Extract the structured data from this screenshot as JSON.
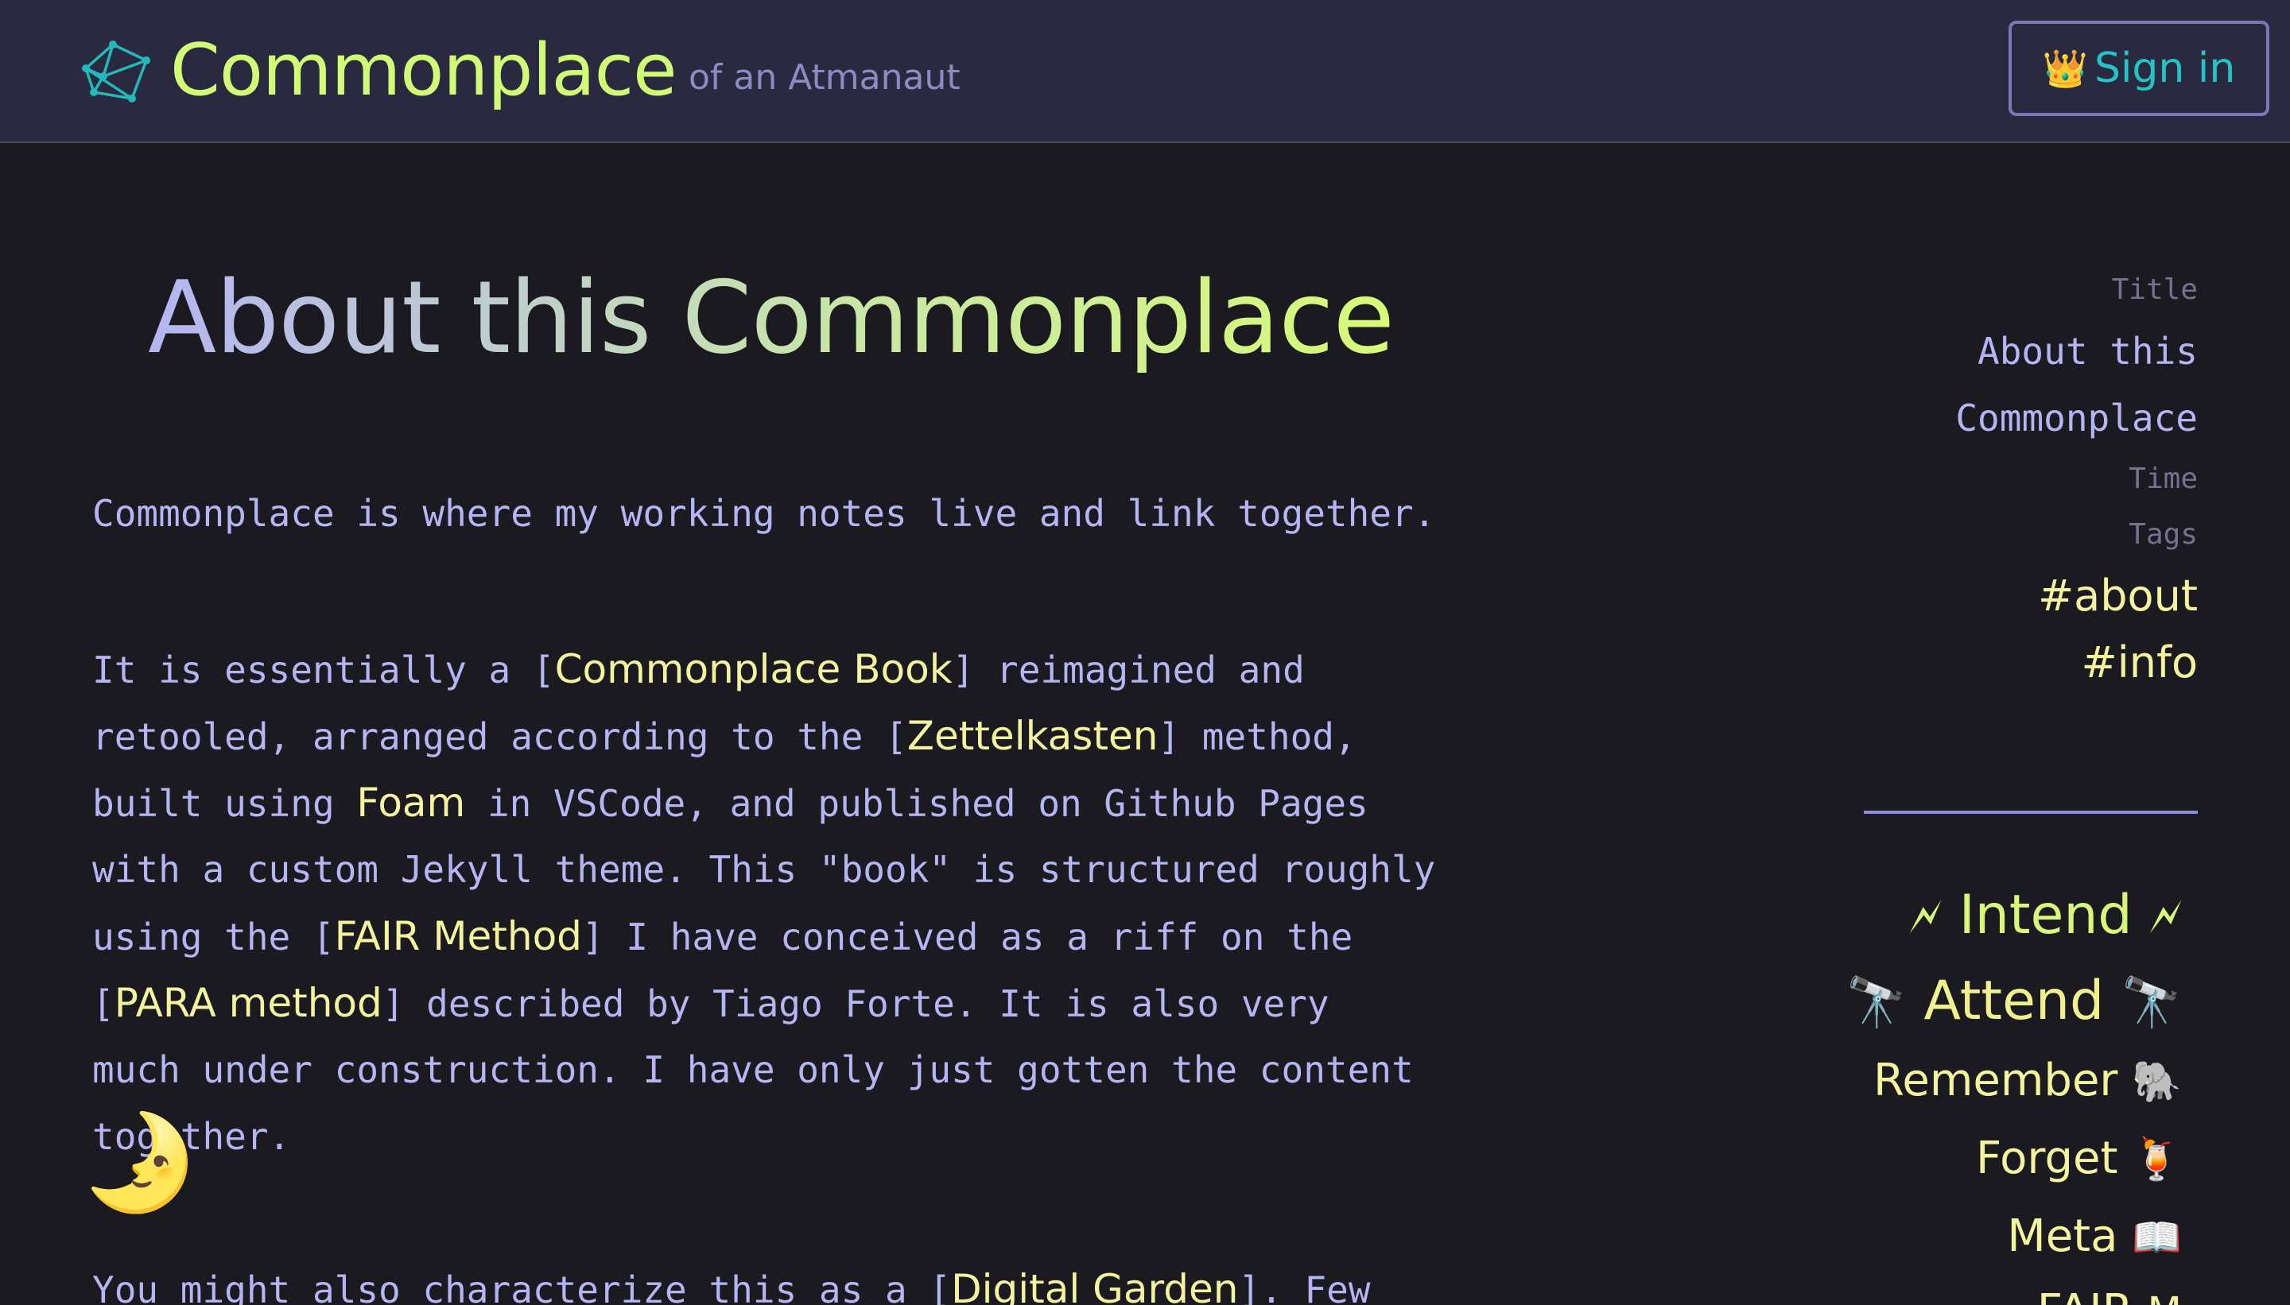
{
  "header": {
    "title": "Commonplace",
    "subtitle": "of an Atmanaut",
    "signin_icon": "👑",
    "signin_label": "Sign in",
    "logo_icon": "constellation-icon"
  },
  "main": {
    "page_title": "About this Commonplace",
    "p1": "Commonplace is where my working notes live and link together.",
    "p2": {
      "l1_a": "It is essentially a [",
      "l1_link": "Commonplace Book",
      "l1_b": "] reimagined and",
      "l2_a": "retooled, arranged according to the [",
      "l2_link": "Zettelkasten",
      "l2_b": "] method,",
      "l3_a": "built using ",
      "l3_link": "Foam",
      "l3_b": " in VSCode, and published on Github Pages",
      "l4": "with a custom Jekyll theme. This \"book\" is structured roughly",
      "l5_a": "using the [",
      "l5_link": "FAIR Method",
      "l5_b": "] I have conceived as a riff on the",
      "l6_a": "[",
      "l6_link": "PARA method",
      "l6_b": "] described by Tiago Forte. It is also very",
      "l7": "much under construction. I have only just gotten the content",
      "l8": "together."
    },
    "p3": {
      "a": "You might also characterize this as a [",
      "link": "Digital Garden",
      "b": "]. Few"
    },
    "theme_toggle": "🌛"
  },
  "sidebar": {
    "title_label": "Title",
    "title_line1": "About this",
    "title_line2": "Commonplace",
    "time_label": "Time",
    "tags_label": "Tags",
    "tags": [
      "#about",
      "#info"
    ],
    "nav": {
      "intend": {
        "label": "Intend",
        "left": "🗲",
        "right": "🗲"
      },
      "attend": {
        "label": "Attend",
        "left": "🔭",
        "right": "🔭"
      },
      "remember": {
        "label": "Remember",
        "icon": "🐘"
      },
      "forget": {
        "label": "Forget",
        "icon": "🍹"
      },
      "meta": {
        "label": "Meta",
        "icon": "📖"
      },
      "fair": {
        "label": "FAIR",
        "icon": "M"
      }
    }
  }
}
